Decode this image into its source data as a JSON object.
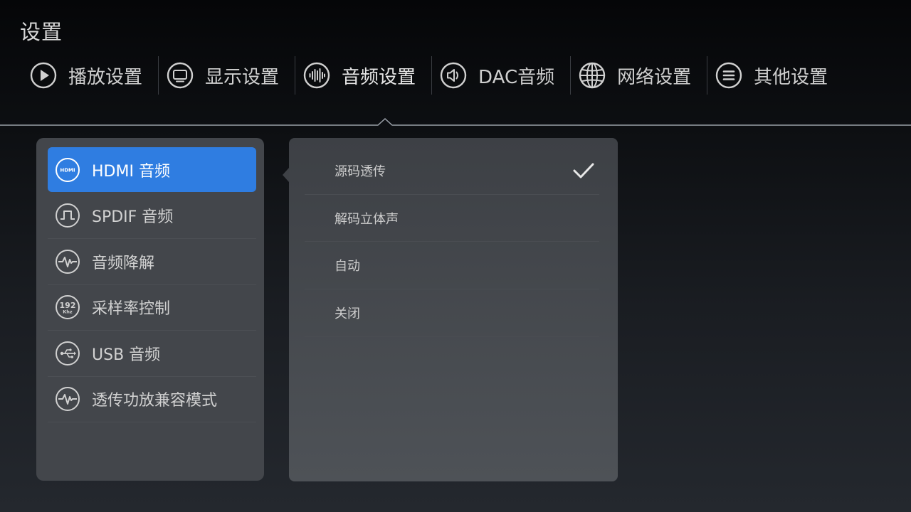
{
  "header": {
    "title": "设置"
  },
  "tabs": [
    {
      "label": "播放设置",
      "icon": "play-icon"
    },
    {
      "label": "显示设置",
      "icon": "display-icon"
    },
    {
      "label": "音频设置",
      "icon": "audio-wave-icon",
      "active": true
    },
    {
      "label": "DAC音频",
      "icon": "speaker-icon"
    },
    {
      "label": "网络设置",
      "icon": "globe-icon"
    },
    {
      "label": "其他设置",
      "icon": "menu-list-icon"
    }
  ],
  "audio_menu": {
    "items": [
      {
        "label": "HDMI 音频",
        "icon": "hdmi-icon",
        "selected": true
      },
      {
        "label": "SPDIF 音频",
        "icon": "spdif-icon"
      },
      {
        "label": "音频降解",
        "icon": "waveform-icon"
      },
      {
        "label": "采样率控制",
        "icon": "sample-rate-icon",
        "icon_text_top": "192",
        "icon_text_bottom": "Khz"
      },
      {
        "label": "USB 音频",
        "icon": "usb-icon"
      },
      {
        "label": "透传功放兼容模式",
        "icon": "waveform-icon"
      }
    ]
  },
  "hdmi_options": {
    "items": [
      {
        "label": "源码透传",
        "checked": true
      },
      {
        "label": "解码立体声"
      },
      {
        "label": "自动"
      },
      {
        "label": "关闭"
      }
    ]
  },
  "colors": {
    "accent": "#2f7de1",
    "panel": "#43464b",
    "icon_stroke": "#d0d0d0"
  }
}
